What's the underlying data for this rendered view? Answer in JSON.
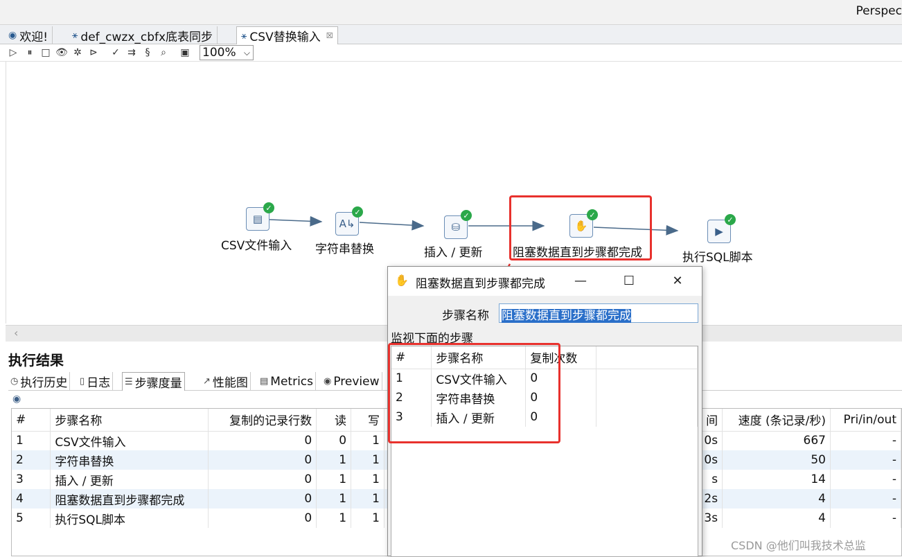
{
  "perspective_label": "Perspec",
  "tabs": [
    {
      "label": "欢迎!",
      "icon": "globe-icon"
    },
    {
      "label": "def_cwzx_cbfx底表同步",
      "icon": "transform-icon"
    },
    {
      "label": "CSV替换输入",
      "icon": "transform-icon",
      "close": "☒"
    }
  ],
  "toolbar": {
    "zoom": "100%"
  },
  "flow": {
    "nodes": [
      {
        "label": "CSV文件输入",
        "icon": "csv-file-icon"
      },
      {
        "label": "字符串替换",
        "icon": "string-replace-icon"
      },
      {
        "label": "插入 / 更新",
        "icon": "insert-update-icon"
      },
      {
        "label": "阻塞数据直到步骤都完成",
        "icon": "block-hand-icon"
      },
      {
        "label": "执行SQL脚本",
        "icon": "sql-script-icon"
      }
    ]
  },
  "results": {
    "title": "执行结果",
    "tabs": [
      "执行历史",
      "日志",
      "步骤度量",
      "性能图",
      "Metrics",
      "Preview"
    ],
    "columns": [
      "#",
      "步骤名称",
      "复制的记录行数",
      "读",
      "写",
      "间",
      "速度 (条记录/秒)",
      "Pri/in/out"
    ],
    "rows": [
      {
        "n": "1",
        "name": "CSV文件输入",
        "copied": "0",
        "read": "0",
        "write": "1",
        "time": "0s",
        "speed": "667",
        "pri": "-"
      },
      {
        "n": "2",
        "name": "字符串替换",
        "copied": "0",
        "read": "1",
        "write": "1",
        "time": "0s",
        "speed": "50",
        "pri": "-"
      },
      {
        "n": "3",
        "name": "插入 / 更新",
        "copied": "0",
        "read": "1",
        "write": "1",
        "time": "s",
        "speed": "14",
        "pri": "-"
      },
      {
        "n": "4",
        "name": "阻塞数据直到步骤都完成",
        "copied": "0",
        "read": "1",
        "write": "1",
        "time": "2s",
        "speed": "4",
        "pri": "-"
      },
      {
        "n": "5",
        "name": "执行SQL脚本",
        "copied": "0",
        "read": "1",
        "write": "1",
        "time": "3s",
        "speed": "4",
        "pri": "-"
      }
    ]
  },
  "dialog": {
    "title": "阻塞数据直到步骤都完成",
    "step_name_label": "步骤名称",
    "step_name_value": "阻塞数据直到步骤都完成",
    "monitor_label": "监视下面的步骤",
    "columns": [
      "#",
      "步骤名称",
      "复制次数"
    ],
    "rows": [
      {
        "n": "1",
        "name": "CSV文件输入",
        "copies": "0"
      },
      {
        "n": "2",
        "name": "字符串替换",
        "copies": "0"
      },
      {
        "n": "3",
        "name": "插入 / 更新",
        "copies": "0"
      }
    ]
  },
  "watermark": "CSDN @他们叫我技术总监",
  "colors": {
    "highlight": "#e8312d",
    "success": "#2ba84a",
    "selection": "#2a6fc9"
  }
}
